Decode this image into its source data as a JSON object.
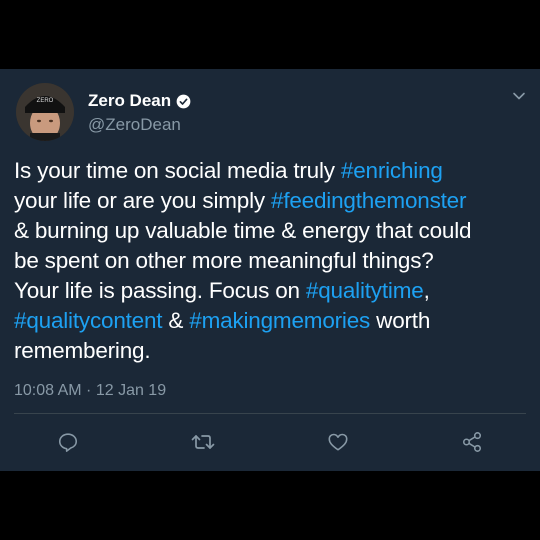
{
  "tweet": {
    "author": {
      "display_name": "Zero Dean",
      "handle": "@ZeroDean",
      "verified": true,
      "cap_text": "ZERO"
    },
    "text_lines": [
      [
        {
          "t": "Is your time on social media truly ",
          "h": false
        },
        {
          "t": "#enriching",
          "h": true
        }
      ],
      [
        {
          "t": "your life or are you simply ",
          "h": false
        },
        {
          "t": "#feedingthemonster",
          "h": true
        }
      ],
      [
        {
          "t": "& burning up valuable time & energy that could",
          "h": false
        }
      ],
      [
        {
          "t": "be spent on other more meaningful things?",
          "h": false
        }
      ],
      [
        {
          "t": "Your life is passing. Focus on ",
          "h": false
        },
        {
          "t": "#qualitytime",
          "h": true
        },
        {
          "t": ",",
          "h": false
        }
      ],
      [
        {
          "t": "#qualitycontent",
          "h": true
        },
        {
          "t": " & ",
          "h": false
        },
        {
          "t": "#makingmemories",
          "h": true
        },
        {
          "t": " worth",
          "h": false
        }
      ],
      [
        {
          "t": "remembering.",
          "h": false
        }
      ]
    ],
    "timestamp": "10:08 AM · 12 Jan 19",
    "actions": [
      {
        "name": "reply-icon"
      },
      {
        "name": "retweet-icon"
      },
      {
        "name": "like-icon"
      },
      {
        "name": "share-icon"
      }
    ]
  },
  "colors": {
    "background": "#000000",
    "card": "#1b2837",
    "text": "#ffffff",
    "secondary": "#8899a6",
    "hashtag": "#1da1f2",
    "divider": "#38444d"
  }
}
